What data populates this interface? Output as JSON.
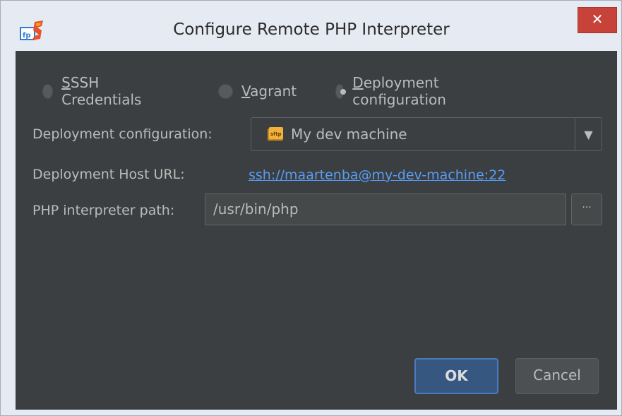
{
  "window": {
    "title": "Configure Remote PHP Interpreter",
    "close_label": "✕",
    "app_icon": "phpstorm-logo-icon"
  },
  "connection_type": {
    "options": [
      {
        "accel": "S",
        "rest": "SSH Credentials",
        "selected": false
      },
      {
        "accel": "V",
        "rest": "agrant",
        "selected": false
      },
      {
        "accel": "D",
        "rest": "eployment configuration",
        "selected": true
      }
    ]
  },
  "form": {
    "deployment_config_label": "Deployment configuration:",
    "deployment_config_value": "My dev machine",
    "deployment_config_icon": "sftp-icon",
    "host_url_label": "Deployment Host URL:",
    "host_url_value": "ssh://maartenba@my-dev-machine:22",
    "interpreter_path_label": "PHP interpreter path:",
    "interpreter_path_value": "/usr/bin/php",
    "browse_label": "···"
  },
  "buttons": {
    "ok": "OK",
    "cancel": "Cancel"
  },
  "colors": {
    "dialog_bg": "#3c3f41",
    "title_bg": "#e6eaf2",
    "close_bg": "#c7433a",
    "link": "#589df6",
    "primary_button": "#365880"
  }
}
